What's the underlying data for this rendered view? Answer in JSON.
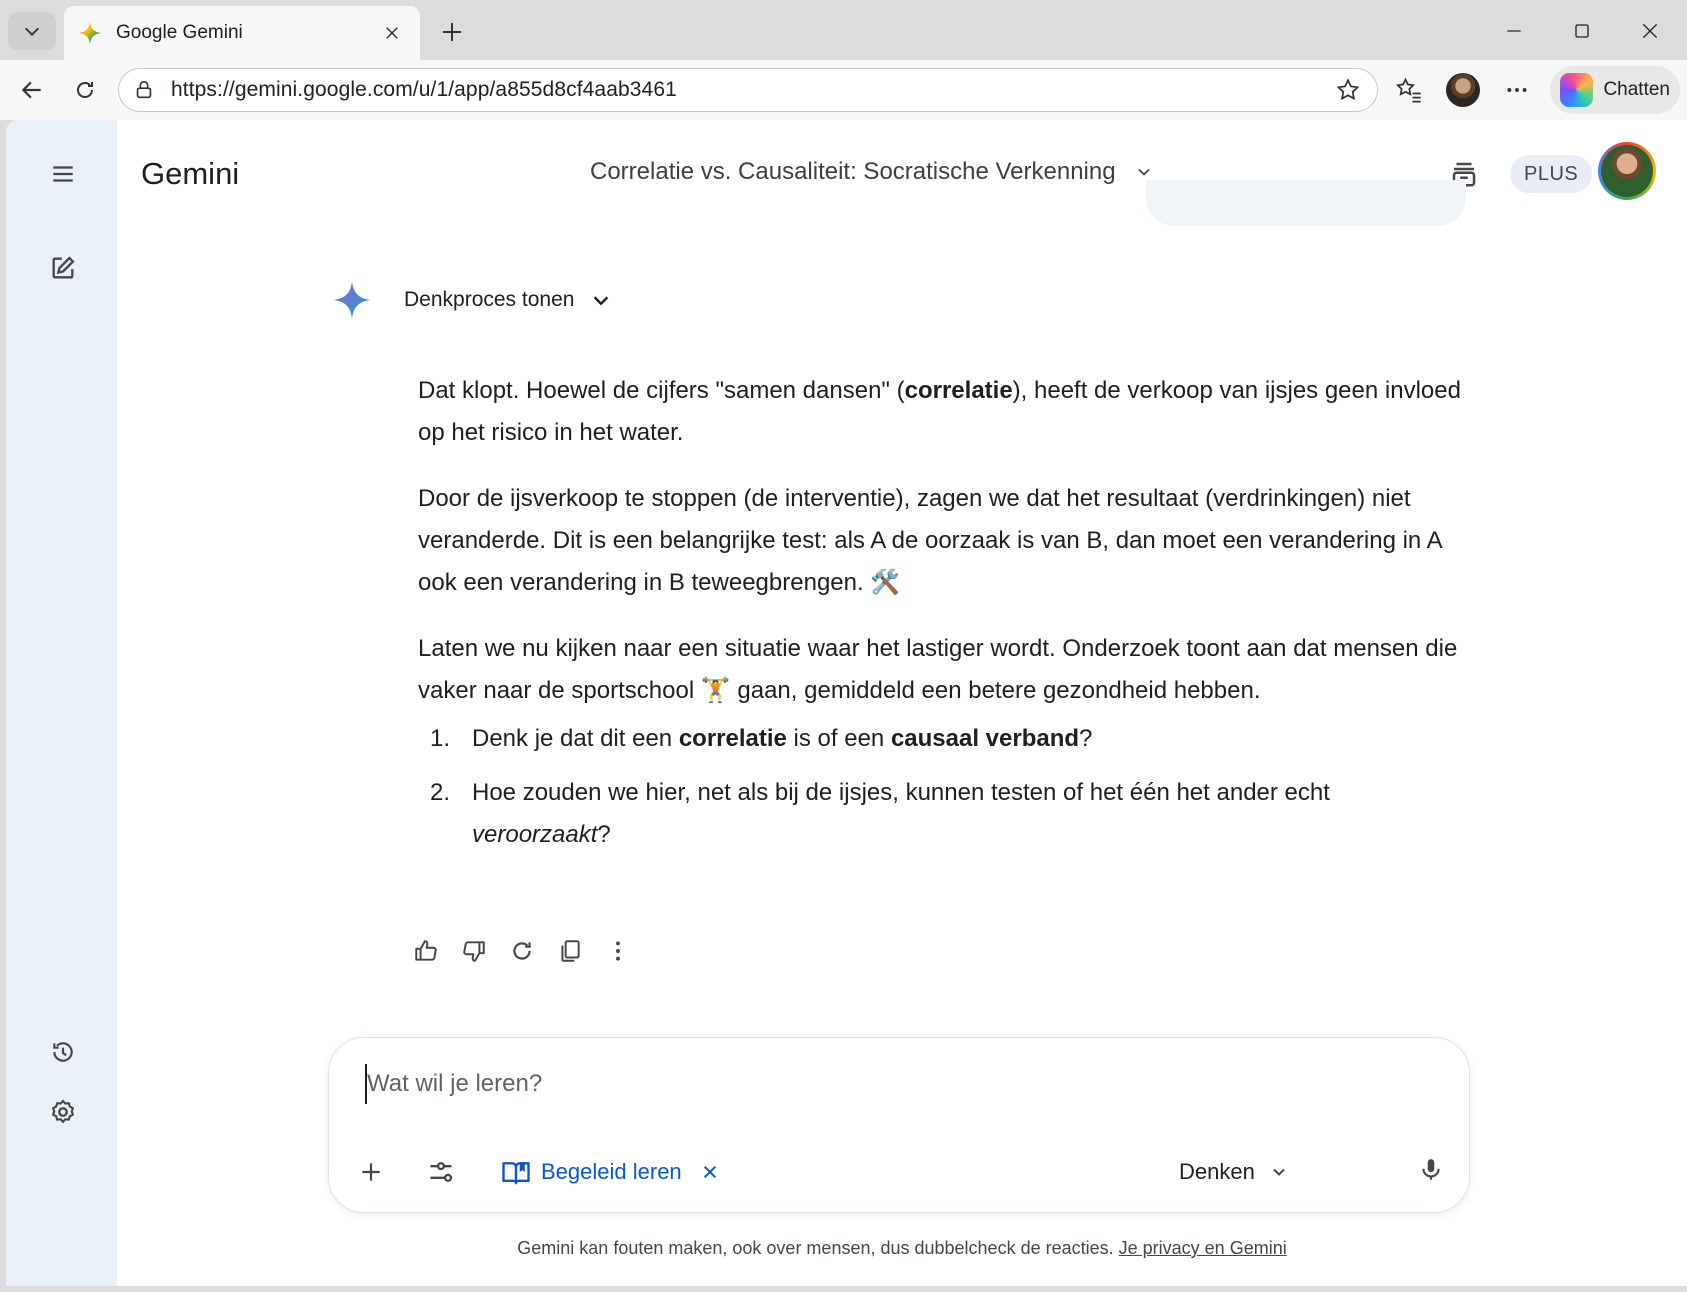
{
  "browser": {
    "tab_title": "Google Gemini",
    "url": "https://gemini.google.com/u/1/app/a855d8cf4aab3461",
    "copilot_label": "Chatten"
  },
  "app": {
    "name": "Gemini",
    "conversation_title": "Correlatie vs. Causaliteit: Socratische Verkenning",
    "plan_badge": "PLUS"
  },
  "response": {
    "thinking_label": "Denkproces tonen",
    "p1": {
      "a": "Dat klopt. Hoewel de cijfers \"samen dansen\" (",
      "b": "correlatie",
      "c": "), heeft de verkoop van ijsjes geen invloed op het risico in het water."
    },
    "p2": "Door de ijsverkoop te stoppen (de interventie), zagen we dat het resultaat (verdrinkingen) niet veranderde. Dit is een belangrijke test: als A de oorzaak is van B, dan moet een verandering in A ook een verandering in B teweegbrengen.",
    "p2_emoji": "🛠️",
    "p3": {
      "a": "Laten we nu kijken naar een situatie waar het lastiger wordt. Onderzoek toont aan dat mensen die vaker naar de sportschool",
      "emoji": "🏋️",
      "b": "gaan, gemiddeld een betere gezondheid hebben."
    },
    "q1": {
      "num": "1.",
      "a": "Denk je dat dit een ",
      "b": "correlatie",
      "c": " is of een ",
      "d": "causaal verband",
      "e": "?"
    },
    "q2": {
      "num": "2.",
      "a": "Hoe zouden we hier, net als bij de ijsjes, kunnen testen of het één het ander echt ",
      "b": "veroorzaakt",
      "c": "?"
    }
  },
  "composer": {
    "placeholder": "Wat wil je leren?",
    "tool_label": "Begeleid leren",
    "model_label": "Denken"
  },
  "footer": {
    "text": "Gemini kan fouten maken, ook over mensen, dus dubbelcheck de reacties.",
    "link": "Je privacy en Gemini"
  },
  "colors": {
    "accent": "#0b57d0",
    "sidebar": "#eaf0f8",
    "chrome": "#dcdcdc"
  }
}
